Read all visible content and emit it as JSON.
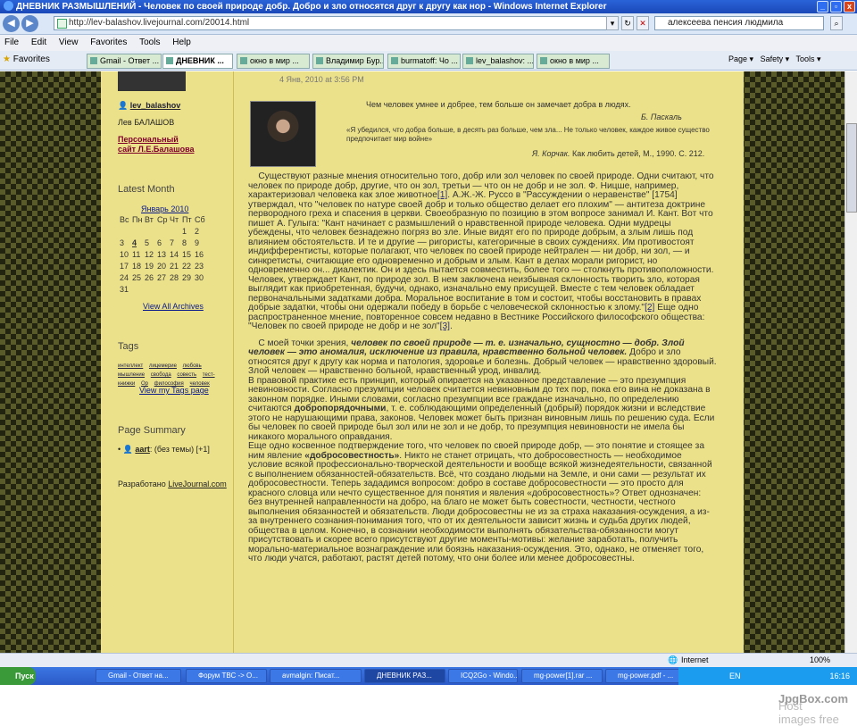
{
  "window": {
    "title": "ДНЕВНИК РАЗМЫШЛЕНИЙ - Человек по своей природе добр. Добро и зло относятся друг к другу как нор - Windows Internet Explorer"
  },
  "address": {
    "url": "http://lev-balashov.livejournal.com/20014.html",
    "search_value": "алексеева пенсия людмила"
  },
  "menu": [
    "File",
    "Edit",
    "View",
    "Favorites",
    "Tools",
    "Help"
  ],
  "favorites_label": "Favorites",
  "tabs": [
    "Gmail - Ответ ...",
    "ДНЕВНИК ...",
    "окно в мир ...",
    "Владимир Бур...",
    "burmatoff: Чо ...",
    "lev_balashov: ...",
    "окно в мир ..."
  ],
  "toolbar_right": [
    "Page ▾",
    "Safety ▾",
    "Tools ▾"
  ],
  "sidebar": {
    "username": "lev_balashov",
    "realname": "Лев БАЛАШОВ",
    "site_link": "Персональный сайт Л.Е.Балашова",
    "latest_month_heading": "Latest Month",
    "calendar_month": "Январь 2010",
    "calendar_head": [
      "Вс",
      "Пн",
      "Вт",
      "Ср",
      "Чт",
      "Пт",
      "Сб"
    ],
    "calendar_rows": [
      [
        "",
        "",
        "",
        "",
        "",
        "1",
        "2"
      ],
      [
        "3",
        "4",
        "5",
        "6",
        "7",
        "8",
        "9"
      ],
      [
        "10",
        "11",
        "12",
        "13",
        "14",
        "15",
        "16"
      ],
      [
        "17",
        "18",
        "19",
        "20",
        "21",
        "22",
        "23"
      ],
      [
        "24",
        "25",
        "26",
        "27",
        "28",
        "29",
        "30"
      ],
      [
        "31",
        "",
        "",
        "",
        "",
        "",
        ""
      ]
    ],
    "view_archives": "View All Archives",
    "tags_heading": "Tags",
    "tags": [
      "интеллект",
      "лицемерие",
      "любовь",
      "мышление",
      "свобода",
      "совесть",
      "тест-книжки",
      "Ор",
      "философия",
      "человек"
    ],
    "view_tags": "View my Tags page",
    "page_summary_heading": "Page Summary",
    "summary_user": "aart",
    "summary_rest": ": (без темы) [+1]",
    "powered_by": "Разработано",
    "powered_link": "LiveJournal.com"
  },
  "post": {
    "date": "4 Янв, 2010 at 3:56 PM",
    "epigraph1": "Чем человек умнее и добрее, тем больше он замечает добра в людях.",
    "epigraph1_author": "Б. Паскаль",
    "epigraph2": "«Я убедился, что добра больше, в десять раз больше, чем зла... Не только человек, каждое живое существо предпочитает мир войне»",
    "epigraph2_author": "Я. Корчак.",
    "epigraph2_source": "Как любить детей, М., 1990. С. 212.",
    "para1_a": "Существуют разные мнения относительно того, добр или зол человек по своей природе. Одни считают, что человек по природе добр, другие, что он зол, третьи — что он не добр и не зол. Ф. Ницше, например, характеризовал человека как злое животное",
    "fn1": "[1]",
    "para1_b": ". А.Ж.-Ж. Руссо в \"Рассуждении о неравенстве\" [1754] утверждал, что \"человек по натуре своей добр и только общество делает его плохим\" — антитеза доктрине первородного греха и спасения в церкви. Своеобразную по позицию в этом вопросе занимал И. Кант. Вот что пишет А. Гулыга: \"Кант начинает с размышлений о нравственной природе человека. Одни мудрецы убеждены, что человек безнадежно погряз во зле. Иные видят его по природе добрым, а злым лишь под влиянием обстоятельств. И те и другие — ригористы, категоричные в своих суждениях. Им противостоят индифферентисты, которые полагают, что человек по своей природе нейтрален — ни добр, ни зол, — и синкретисты, считающие его одновременно и добрым и злым. Кант в делах морали ригорист, но одновременно он... диалектик. Он и здесь пытается совместить, более того — столкнуть противоположности. Человек, утверждает Кант, по природе зол. В нем заключена неизбывная склонность творить зло, которая выглядит как приобретенная, будучи, однако, изначально ему присущей. Вместе с тем человек обладает первоначальными задатками добра. Моральное воспитание в том и состоит, чтобы восстановить в правах добрые задатки, чтобы они одержали победу в борьбе с человеческой склонностью к злому.\"",
    "fn2": "[2]",
    "para1_c": " Еще одно распространенное мнение, повторенное совсем недавно в Вестнике Российского философского общества: \"Человек по своей природе не добр и не зол\"",
    "fn3": "[3]",
    "para1_d": ".",
    "para2_a": "С моей точки зрения, ",
    "para2_bold": "человек по своей природе — т. е. изначально, сущностно — добр. Злой человек — это аномалия, исключение из правила, нравственно больной человек.",
    "para2_b": " Добро и зло относятся друг к другу как норма и патология, здоровье и болезнь. Добрый человек — нравственно здоровый. Злой человек — нравственно больной, нравственный урод, инвалид.",
    "para3_a": "В правовой практике есть принцип, который опирается на указанное представление — это презумпция невиновности. Согласно презумпции человек считается невиновным до тех пор, пока его вина не доказана в законном порядке. Иными словами, согласно презумпции все граждане изначально, по определению считаются ",
    "para3_bold": "добропорядочными",
    "para3_b": ", т. е. соблюдающими определенный (добрый) порядок жизни и вследствие этого не нарушающими права, законов. Человек может быть признан виновным лишь по решению суда. Если бы человек по своей природе был зол или не зол и не добр, то презумпция невиновности не имела бы никакого морального оправдания.",
    "para4_a": "Еще одно косвенное подтверждение того, что человек по своей природе добр, — это понятие и стоящее за ним явление ",
    "para4_bold": "«добросовестность»",
    "para4_b": ". Никто не станет отрицать, что добросовестность — необходимое условие всякой профессионально-творческой деятельности и вообще всякой жизнедеятельности, связанной с выполнением обязанностей-обязательств. Всё, что создано людьми на Земле, и они сами — результат их добросовестности. Теперь зададимся вопросом: добро в составе добросовестности — это просто для красного словца или нечто существенное для понятия и явления «добросовестность»? Ответ однозначен: без внутренней направленности на добро, на благо не может быть совестности, честности, честного выполнения обязанностей и обязательств. Люди добросовестны не из за страха наказания-осуждения, а из-за внутреннего сознания-понимания того, что от их деятельности зависит жизнь и судьба других людей, общества в целом. Конечно, в сознании необходимости выполнять обязательства-обязанности могут присутствовать и скорее всего присутствуют другие моменты-мотивы: желание заработать, получить морально-материальное вознаграждение или боязнь наказания-осуждения. Это, однако, не отменяет того, что люди учатся, работают, растят детей потому, что они более или менее добросовестны."
  },
  "status": {
    "zone": "Internet",
    "zoom": "100%"
  },
  "taskbar": {
    "start": "Пуск",
    "items": [
      "Gmail - Ответ на...",
      "Форум ТВС -> О...",
      "avmalgin: Писат...",
      "ДНЕВНИК РАЗ...",
      "ICQ2Go - Windo...",
      "mg-power[1].rar ...",
      "mg-power.pdf - ..."
    ],
    "lang": "EN",
    "clock": "16:16"
  },
  "footer": {
    "prefix": "Host images free ",
    "brand": "JpgBox.com"
  }
}
